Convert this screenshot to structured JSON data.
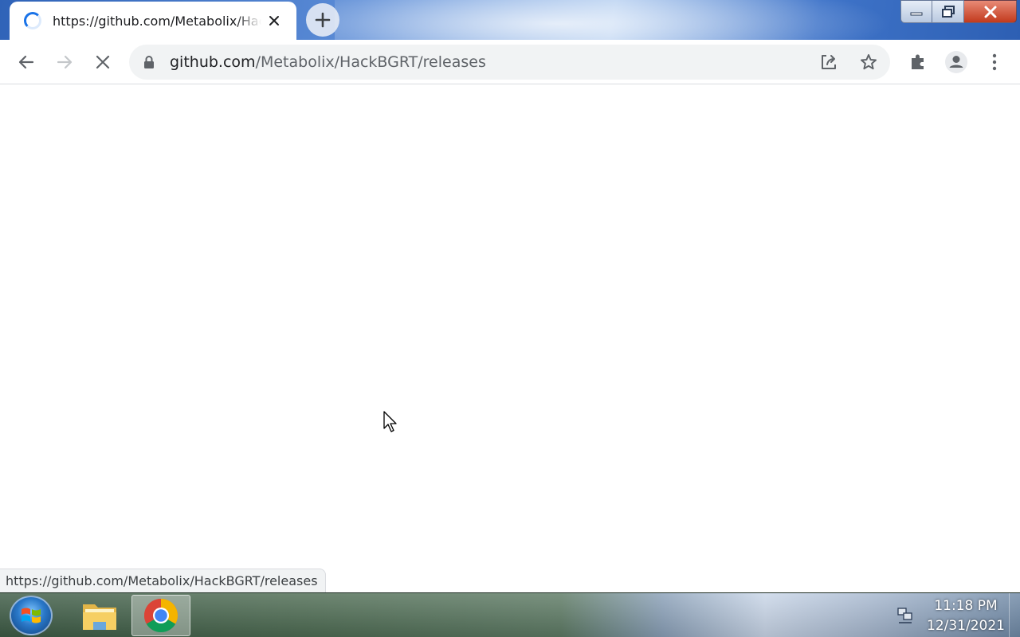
{
  "browser": {
    "tab": {
      "title": "https://github.com/Metabolix/HackBGRT/releases",
      "close_icon": "close-icon",
      "loading_icon": "spinner-icon"
    },
    "new_tab_icon": "plus-icon",
    "window_controls": [
      "minimize-icon",
      "restore-icon",
      "close-icon"
    ],
    "toolbar": {
      "back_icon": "arrow-left-icon",
      "forward_icon": "arrow-right-icon",
      "stop_icon": "close-icon",
      "extensions_icon": "puzzle-icon",
      "profile_icon": "person-icon",
      "menu_icon": "kebab-menu-icon"
    },
    "omnibox": {
      "lock_icon": "lock-icon",
      "url_host": "github.com",
      "url_path": "/Metabolix/HackBGRT/releases",
      "share_icon": "share-icon",
      "bookmark_icon": "star-icon"
    },
    "status_bubble": "https://github.com/Metabolix/HackBGRT/releases"
  },
  "taskbar": {
    "start_icon": "windows-logo-icon",
    "items": [
      {
        "name": "file-explorer",
        "icon": "folder-icon",
        "active": false
      },
      {
        "name": "chrome",
        "icon": "chrome-icon",
        "active": true
      }
    ],
    "tray": {
      "network_icon": "network-icon",
      "time": "11:18 PM",
      "date": "12/31/2021"
    }
  },
  "colors": {
    "accent": "#1a73e8",
    "omnibox_bg": "#f1f3f4",
    "text_primary": "#202124",
    "text_secondary": "#5f6368"
  }
}
